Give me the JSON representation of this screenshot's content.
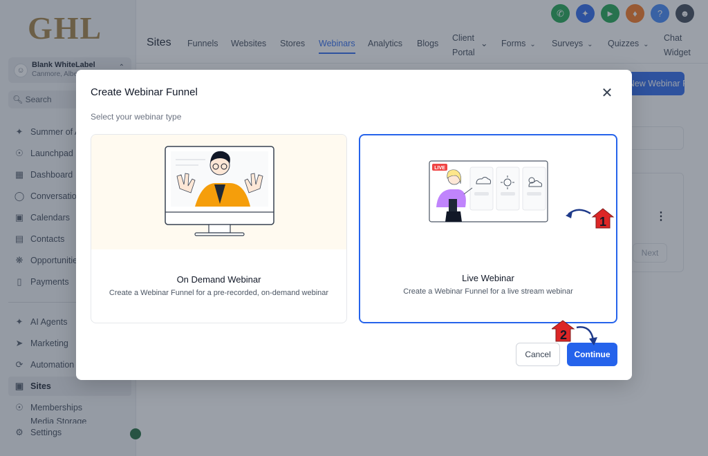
{
  "logo": "GHL",
  "account": {
    "name": "Blank WhiteLabel",
    "location": "Canmore, Alberta"
  },
  "search": {
    "label": "Search"
  },
  "sidebar": {
    "items": [
      {
        "label": "Summer of AI",
        "icon": "sparkle-icon"
      },
      {
        "label": "Launchpad",
        "icon": "rocket-icon"
      },
      {
        "label": "Dashboard",
        "icon": "grid-icon"
      },
      {
        "label": "Conversations",
        "icon": "chat-icon"
      },
      {
        "label": "Calendars",
        "icon": "calendar-icon"
      },
      {
        "label": "Contacts",
        "icon": "contacts-icon"
      },
      {
        "label": "Opportunities",
        "icon": "opportunities-icon"
      },
      {
        "label": "Payments",
        "icon": "payments-icon"
      },
      {
        "label": "AI Agents",
        "icon": "ai-agents-icon"
      },
      {
        "label": "Marketing",
        "icon": "send-icon"
      },
      {
        "label": "Automation",
        "icon": "automation-icon"
      },
      {
        "label": "Sites",
        "icon": "sites-icon",
        "active": true
      },
      {
        "label": "Memberships",
        "icon": "memberships-icon"
      },
      {
        "label": "Media Storage",
        "icon": "media-icon"
      },
      {
        "label": "Settings",
        "icon": "gear-icon"
      }
    ]
  },
  "topbar": {
    "title": "Sites",
    "tabs": [
      "Funnels",
      "Websites",
      "Stores",
      "Webinars",
      "Analytics",
      "Blogs"
    ],
    "active_tab": "Webinars",
    "client_portal": [
      "Client",
      "Portal"
    ],
    "dropdown_tabs": [
      "Forms",
      "Surveys",
      "Quizzes"
    ],
    "chat_widget": [
      "Chat",
      "Widget"
    ],
    "icons": [
      "phone-icon",
      "magic-icon",
      "megaphone-icon",
      "bell-icon",
      "help-icon",
      "user-avatar"
    ]
  },
  "background": {
    "new_button": "+ New Webinar Funnel",
    "next_button": "Next"
  },
  "modal": {
    "title": "Create Webinar Funnel",
    "subtitle": "Select your webinar type",
    "cards": [
      {
        "title": "On Demand Webinar",
        "description": "Create a Webinar Funnel for a pre-recorded, on-demand webinar"
      },
      {
        "title": "Live Webinar",
        "description": "Create a Webinar Funnel for a live stream webinar",
        "selected": true
      }
    ],
    "live_badge": "LIVE",
    "cancel_label": "Cancel",
    "continue_label": "Continue"
  },
  "annotations": {
    "step1": "1",
    "step2": "2"
  },
  "colors": {
    "primary": "#2563eb",
    "annotation_red": "#dc2626",
    "annotation_arrow": "#1e3a8a",
    "logo_gold": "#a07d3c"
  }
}
